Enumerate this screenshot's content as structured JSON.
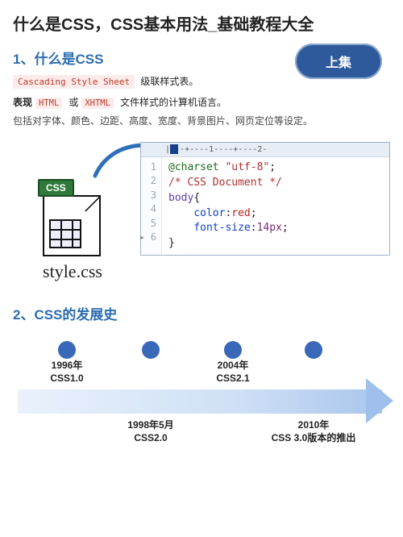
{
  "title": "什么是CSS，CSS基本用法_基础教程大全",
  "badge": "上集",
  "sections": {
    "s1": {
      "heading": "1、什么是CSS"
    },
    "s2": {
      "heading": "2、CSS的发展史"
    }
  },
  "intro": {
    "chip_cascading": "Cascading Style Sheet",
    "chip_suffix": "级联样式表。",
    "presents_prefix": "表现",
    "chip_html": "HTML",
    "sep": "或",
    "chip_xhtml": "XHTML",
    "presents_suffix": "文件样式的计算机语言。",
    "includes": "包括对字体、颜色、边距、高度、宽度、背景图片、网页定位等设定。"
  },
  "file": {
    "tag": "CSS",
    "name": "style.css"
  },
  "editor": {
    "ruler_text": "|---+----1----+----2-",
    "gutter": [
      "1",
      "2",
      "3",
      "4",
      "5",
      "6"
    ],
    "code": {
      "l1_dir": "@charset ",
      "l1_str": "\"utf-8\"",
      "l1_end": ";",
      "l2_cmt": "/* CSS Document */",
      "l3_sel": "body",
      "l3_brace": "{",
      "l4_prop": "color",
      "l4_colon": ":",
      "l4_val": "red",
      "l4_end": ";",
      "l5_prop": "font-size",
      "l5_colon": ":",
      "l5_val": "14px",
      "l5_end": ";",
      "l6_brace": "}"
    }
  },
  "timeline": {
    "items": [
      {
        "pos": 56,
        "side": "above",
        "year": "1996年",
        "label": "CSS1.0"
      },
      {
        "pos": 160,
        "side": "below",
        "year": "1998年5月",
        "label": "CSS2.0"
      },
      {
        "pos": 262,
        "side": "above",
        "year": "2004年",
        "label": "CSS2.1"
      },
      {
        "pos": 362,
        "side": "below",
        "year": "2010年",
        "label": "CSS 3.0版本的推出"
      }
    ]
  }
}
